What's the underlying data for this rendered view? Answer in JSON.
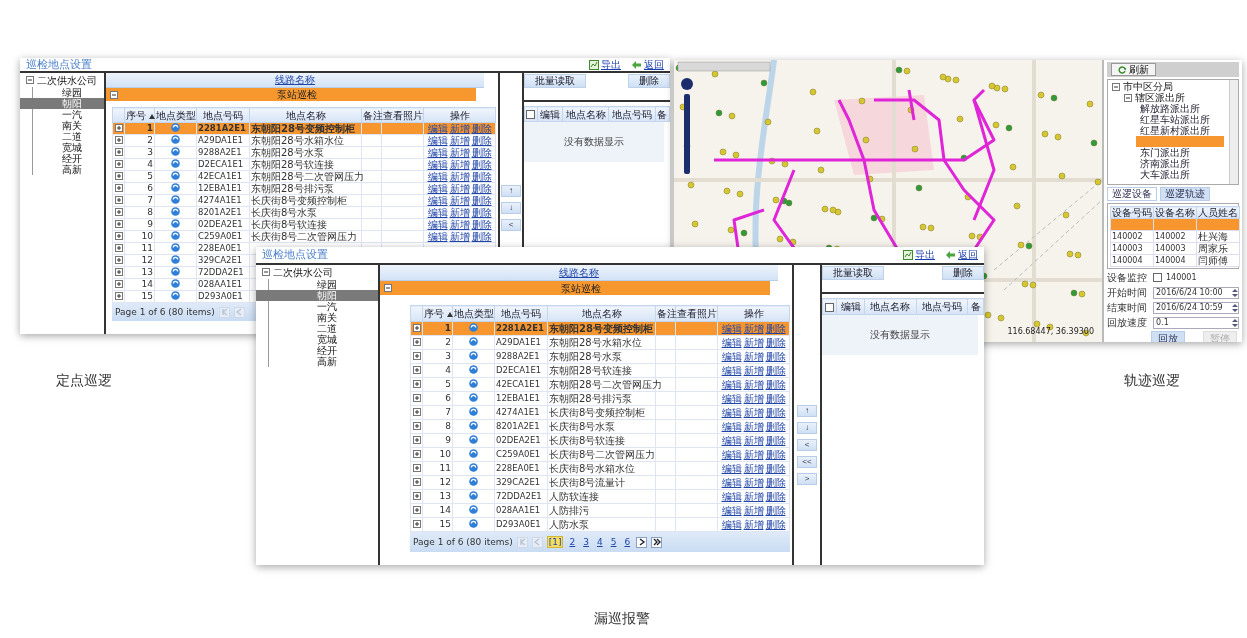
{
  "windows": [
    {
      "kind": "point_setup",
      "title": "巡检地点设置",
      "links": [
        {
          "label": "导出"
        },
        {
          "label": "返回"
        }
      ],
      "tree": {
        "label": "二次供水公司",
        "expanded": true,
        "children": [
          {
            "label": "绿园",
            "selected": false
          },
          {
            "label": "朝阳",
            "selected": true
          },
          {
            "label": "一汽",
            "selected": false
          },
          {
            "label": "南关",
            "selected": false
          },
          {
            "label": "二道",
            "selected": false
          },
          {
            "label": "宽城",
            "selected": false
          },
          {
            "label": "经开",
            "selected": false
          },
          {
            "label": "高新",
            "selected": false
          }
        ]
      },
      "route_header": "线路名称",
      "group": {
        "label": "泵站巡检",
        "expanded": true
      },
      "columns": [
        {
          "label": "序号",
          "sorted": true
        },
        {
          "label": "地点类型",
          "sorted": false
        },
        {
          "label": "地点号码",
          "sorted": false
        },
        {
          "label": "地点名称",
          "sorted": false
        },
        {
          "label": "备注",
          "sorted": false
        },
        {
          "label": "查看照片",
          "sorted": false
        },
        {
          "label": "操作",
          "sorted": false
        }
      ],
      "rows": [
        {
          "no": "1",
          "code": "2281A2E1",
          "name": "东朝阳28号变频控制柜",
          "selected": true,
          "ops": [
            "编辑",
            "新增",
            "删除"
          ]
        },
        {
          "no": "2",
          "code": "A29DA1E1",
          "name": "东朝阳28号水箱水位",
          "selected": false,
          "ops": [
            "编辑",
            "新增",
            "删除"
          ]
        },
        {
          "no": "3",
          "code": "9288A2E1",
          "name": "东朝阳28号水泵",
          "selected": false,
          "ops": [
            "编辑",
            "新增",
            "删除"
          ]
        },
        {
          "no": "4",
          "code": "D2ECA1E1",
          "name": "东朝阳28号软连接",
          "selected": false,
          "ops": [
            "编辑",
            "新增",
            "删除"
          ]
        },
        {
          "no": "5",
          "code": "42ECA1E1",
          "name": "东朝阳28号二次管网压力",
          "selected": false,
          "ops": [
            "编辑",
            "新增",
            "删除"
          ]
        },
        {
          "no": "6",
          "code": "12EBA1E1",
          "name": "东朝阳28号排污泵",
          "selected": false,
          "ops": [
            "编辑",
            "新增",
            "删除"
          ]
        },
        {
          "no": "7",
          "code": "4274A1E1",
          "name": "长庆街8号变频控制柜",
          "selected": false,
          "ops": [
            "编辑",
            "新增",
            "删除"
          ]
        },
        {
          "no": "8",
          "code": "8201A2E1",
          "name": "长庆街8号水泵",
          "selected": false,
          "ops": [
            "编辑",
            "新增",
            "删除"
          ]
        },
        {
          "no": "9",
          "code": "02DEA2E1",
          "name": "长庆街8号软连接",
          "selected": false,
          "ops": [
            "编辑",
            "新增",
            "删除"
          ]
        },
        {
          "no": "10",
          "code": "C259A0E1",
          "name": "长庆街8号二次管网压力",
          "selected": false,
          "ops": [
            "编辑",
            "新增",
            "删除"
          ]
        },
        {
          "no": "11",
          "code": "228EA0E1",
          "selected": false
        },
        {
          "no": "12",
          "code": "329CA2E1",
          "selected": false
        },
        {
          "no": "13",
          "code": "72DDA2E1",
          "selected": false
        },
        {
          "no": "14",
          "code": "028AA1E1",
          "selected": false
        },
        {
          "no": "15",
          "code": "D293A0E1",
          "selected": false
        }
      ],
      "pager": {
        "summary": "Page 1 of 6 (80 items)",
        "before": [
          {
            "kind": "first",
            "disabled": true
          },
          {
            "kind": "prev",
            "disabled": true
          }
        ]
      },
      "move_buttons": [
        {
          "label": "↑"
        },
        {
          "label": "↓"
        },
        {
          "label": "<"
        }
      ],
      "right": {
        "buttons": [
          "批量读取",
          "删除"
        ],
        "all_checked": false,
        "columns": [
          "编辑",
          "地点名称",
          "地点号码",
          "备"
        ],
        "empty": "没有数据显示"
      }
    },
    {
      "kind": "track_map",
      "coordinates": "116.68447, 36.39300",
      "refresh": "刷新",
      "tree": {
        "label": "市中区分局",
        "expanded": true,
        "children": [
          {
            "label": "辖区派出所",
            "expanded": true,
            "children": [
              {
                "label": "解放路派出所",
                "selected": false
              },
              {
                "label": "红星车站派出所",
                "selected": false
              },
              {
                "label": "红星新村派出所",
                "selected": false
              },
              {
                "selected": true
              },
              {
                "label": "东门派出所",
                "selected": false
              },
              {
                "label": "济南派出所",
                "selected": false
              },
              {
                "label": "大车派出所",
                "selected": false
              }
            ]
          }
        ]
      },
      "tabs": [
        {
          "label": "巡逻设备",
          "selected": false
        },
        {
          "label": "巡逻轨迹",
          "selected": true
        }
      ],
      "columns": [
        "设备号码",
        "设备名称",
        "人员姓名"
      ],
      "rows": [
        {
          "selected": true
        },
        {
          "cells": [
            "140002",
            "140002",
            "杜兴海"
          ],
          "selected": false
        },
        {
          "cells": [
            "140003",
            "140003",
            "周家乐"
          ],
          "selected": false
        },
        {
          "cells": [
            "140004",
            "140004",
            "闫师傅"
          ],
          "selected": false
        }
      ],
      "form": [
        {
          "kind": "checkbox",
          "label": "设备监控",
          "value": "140001",
          "checked": false
        },
        {
          "kind": "spin",
          "label": "开始时间",
          "value": "2016/6/24 10:00"
        },
        {
          "kind": "spin",
          "label": "结束时间",
          "value": "2016/6/24 10:59"
        },
        {
          "kind": "spin",
          "label": "回放速度",
          "value": "0.1"
        }
      ],
      "buttons": [
        {
          "label": "回放",
          "disabled": false
        },
        {
          "label": "暂停",
          "disabled": true
        }
      ]
    },
    {
      "kind": "point_setup",
      "title": "巡检地点设置",
      "links": [
        {
          "label": "导出"
        },
        {
          "label": "返回"
        }
      ],
      "tree": {
        "label": "二次供水公司",
        "expanded": true,
        "children": [
          {
            "label": "绿园",
            "selected": false
          },
          {
            "label": "朝阳",
            "selected": true
          },
          {
            "label": "一汽",
            "selected": false
          },
          {
            "label": "南关",
            "selected": false
          },
          {
            "label": "二道",
            "selected": false
          },
          {
            "label": "宽城",
            "selected": false
          },
          {
            "label": "经开",
            "selected": false
          },
          {
            "label": "高新",
            "selected": false
          }
        ]
      },
      "route_header": "线路名称",
      "group": {
        "label": "泵站巡检",
        "expanded": true
      },
      "columns": [
        {
          "label": "序号",
          "sorted": true
        },
        {
          "label": "地点类型",
          "sorted": false
        },
        {
          "label": "地点号码",
          "sorted": false
        },
        {
          "label": "地点名称",
          "sorted": false
        },
        {
          "label": "备注",
          "sorted": false
        },
        {
          "label": "查看照片",
          "sorted": false
        },
        {
          "label": "操作",
          "sorted": false
        }
      ],
      "rows": [
        {
          "no": "1",
          "code": "2281A2E1",
          "name": "东朝阳28号变频控制柜",
          "selected": true,
          "ops": [
            "编辑",
            "新增",
            "删除"
          ]
        },
        {
          "no": "2",
          "code": "A29DA1E1",
          "name": "东朝阳28号水箱水位",
          "selected": false,
          "ops": [
            "编辑",
            "新增",
            "删除"
          ]
        },
        {
          "no": "3",
          "code": "9288A2E1",
          "name": "东朝阳28号水泵",
          "selected": false,
          "ops": [
            "编辑",
            "新增",
            "删除"
          ]
        },
        {
          "no": "4",
          "code": "D2ECA1E1",
          "name": "东朝阳28号软连接",
          "selected": false,
          "ops": [
            "编辑",
            "新增",
            "删除"
          ]
        },
        {
          "no": "5",
          "code": "42ECA1E1",
          "name": "东朝阳28号二次管网压力",
          "selected": false,
          "ops": [
            "编辑",
            "新增",
            "删除"
          ]
        },
        {
          "no": "6",
          "code": "12EBA1E1",
          "name": "东朝阳28号排污泵",
          "selected": false,
          "ops": [
            "编辑",
            "新增",
            "删除"
          ]
        },
        {
          "no": "7",
          "code": "4274A1E1",
          "name": "长庆街8号变频控制柜",
          "selected": false,
          "ops": [
            "编辑",
            "新增",
            "删除"
          ]
        },
        {
          "no": "8",
          "code": "8201A2E1",
          "name": "长庆街8号水泵",
          "selected": false,
          "ops": [
            "编辑",
            "新增",
            "删除"
          ]
        },
        {
          "no": "9",
          "code": "02DEA2E1",
          "name": "长庆街8号软连接",
          "selected": false,
          "ops": [
            "编辑",
            "新增",
            "删除"
          ]
        },
        {
          "no": "10",
          "code": "C259A0E1",
          "name": "长庆街8号二次管网压力",
          "selected": false,
          "ops": [
            "编辑",
            "新增",
            "删除"
          ]
        },
        {
          "no": "11",
          "code": "228EA0E1",
          "name": "长庆街8号水箱水位",
          "selected": false,
          "ops": [
            "编辑",
            "新增",
            "删除"
          ]
        },
        {
          "no": "12",
          "code": "329CA2E1",
          "name": "长庆街8号流量计",
          "selected": false,
          "ops": [
            "编辑",
            "新增",
            "删除"
          ]
        },
        {
          "no": "13",
          "code": "72DDA2E1",
          "name": "人防软连接",
          "selected": false,
          "ops": [
            "编辑",
            "新增",
            "删除"
          ]
        },
        {
          "no": "14",
          "code": "028AA1E1",
          "name": "人防排污",
          "selected": false,
          "ops": [
            "编辑",
            "新增",
            "删除"
          ]
        },
        {
          "no": "15",
          "code": "D293A0E1",
          "name": "人防水泵",
          "selected": false,
          "ops": [
            "编辑",
            "新增",
            "删除"
          ]
        }
      ],
      "pager": {
        "summary": "Page 1 of 6 (80 items)",
        "before": [
          {
            "kind": "first",
            "disabled": true
          },
          {
            "kind": "prev",
            "disabled": true
          }
        ],
        "pages": [
          {
            "label": "[1]",
            "selected": true
          },
          {
            "label": "2",
            "selected": false
          },
          {
            "label": "3",
            "selected": false
          },
          {
            "label": "4",
            "selected": false
          },
          {
            "label": "5",
            "selected": false
          },
          {
            "label": "6",
            "selected": false
          }
        ],
        "after": [
          {
            "kind": "next",
            "disabled": false
          },
          {
            "kind": "last",
            "disabled": false
          }
        ]
      },
      "move_buttons": [
        {
          "label": "↑"
        },
        {
          "label": "↓"
        },
        {
          "label": "<"
        },
        {
          "label": "<<"
        },
        {
          "label": ">"
        }
      ],
      "right": {
        "buttons": [
          "批量读取",
          "删除"
        ],
        "all_checked": false,
        "columns": [
          "编辑",
          "地点名称",
          "地点号码",
          "备"
        ],
        "empty": "没有数据显示"
      }
    }
  ],
  "captions": [
    "定点巡逻",
    "轨迹巡逻",
    "漏巡报警"
  ]
}
